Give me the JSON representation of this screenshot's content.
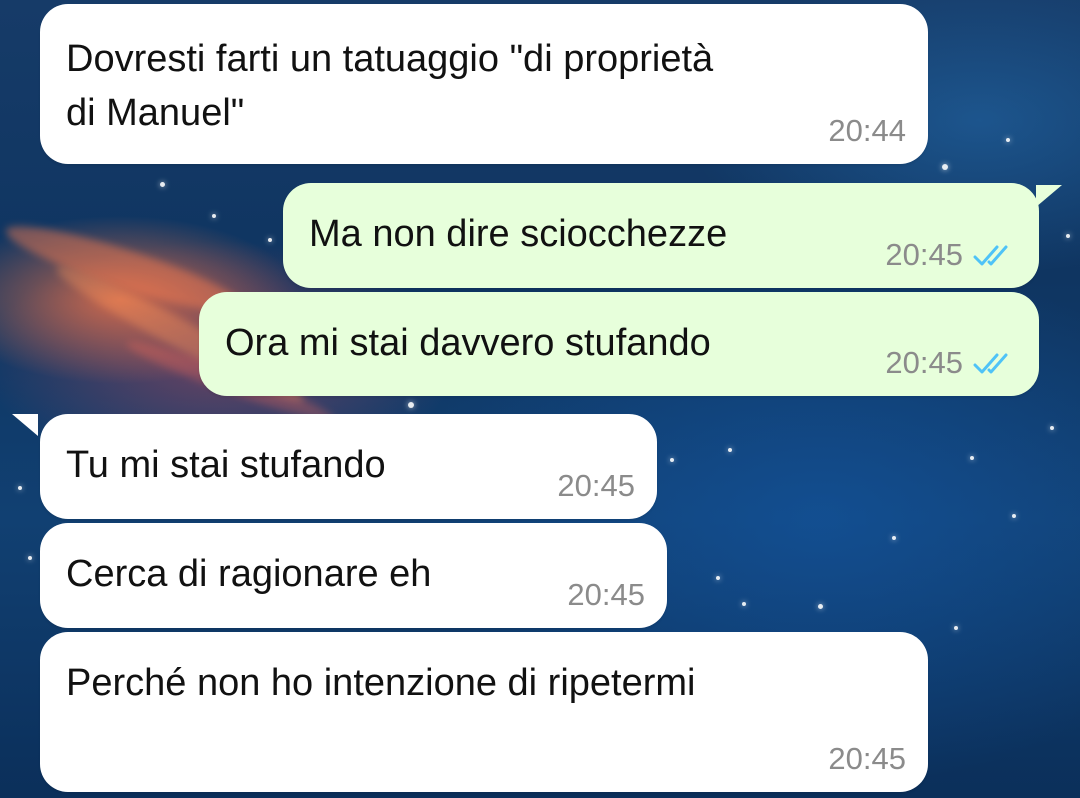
{
  "messages": [
    {
      "direction": "incoming",
      "text": "Dovresti farti un tatuaggio \"di proprietà\ndi Manuel\"",
      "time": "20:44"
    },
    {
      "direction": "outgoing",
      "text": "Ma non dire sciocchezze",
      "time": "20:45",
      "status_icon": "double-check-icon",
      "status_color": "#4fc3f7"
    },
    {
      "direction": "outgoing",
      "text": "Ora mi stai davvero stufando",
      "time": "20:45",
      "status_icon": "double-check-icon",
      "status_color": "#4fc3f7"
    },
    {
      "direction": "incoming",
      "text": "Tu mi stai stufando",
      "time": "20:45"
    },
    {
      "direction": "incoming",
      "text": "Cerca di ragionare eh",
      "time": "20:45"
    },
    {
      "direction": "incoming",
      "text": "Perché non ho intenzione di ripetermi",
      "time": "20:45"
    }
  ],
  "theme": {
    "incoming_bubble_color": "#ffffff",
    "outgoing_bubble_color": "#e7ffdb",
    "timestamp_color": "#8b8b8b",
    "read_receipt_color": "#4fc3f7"
  }
}
